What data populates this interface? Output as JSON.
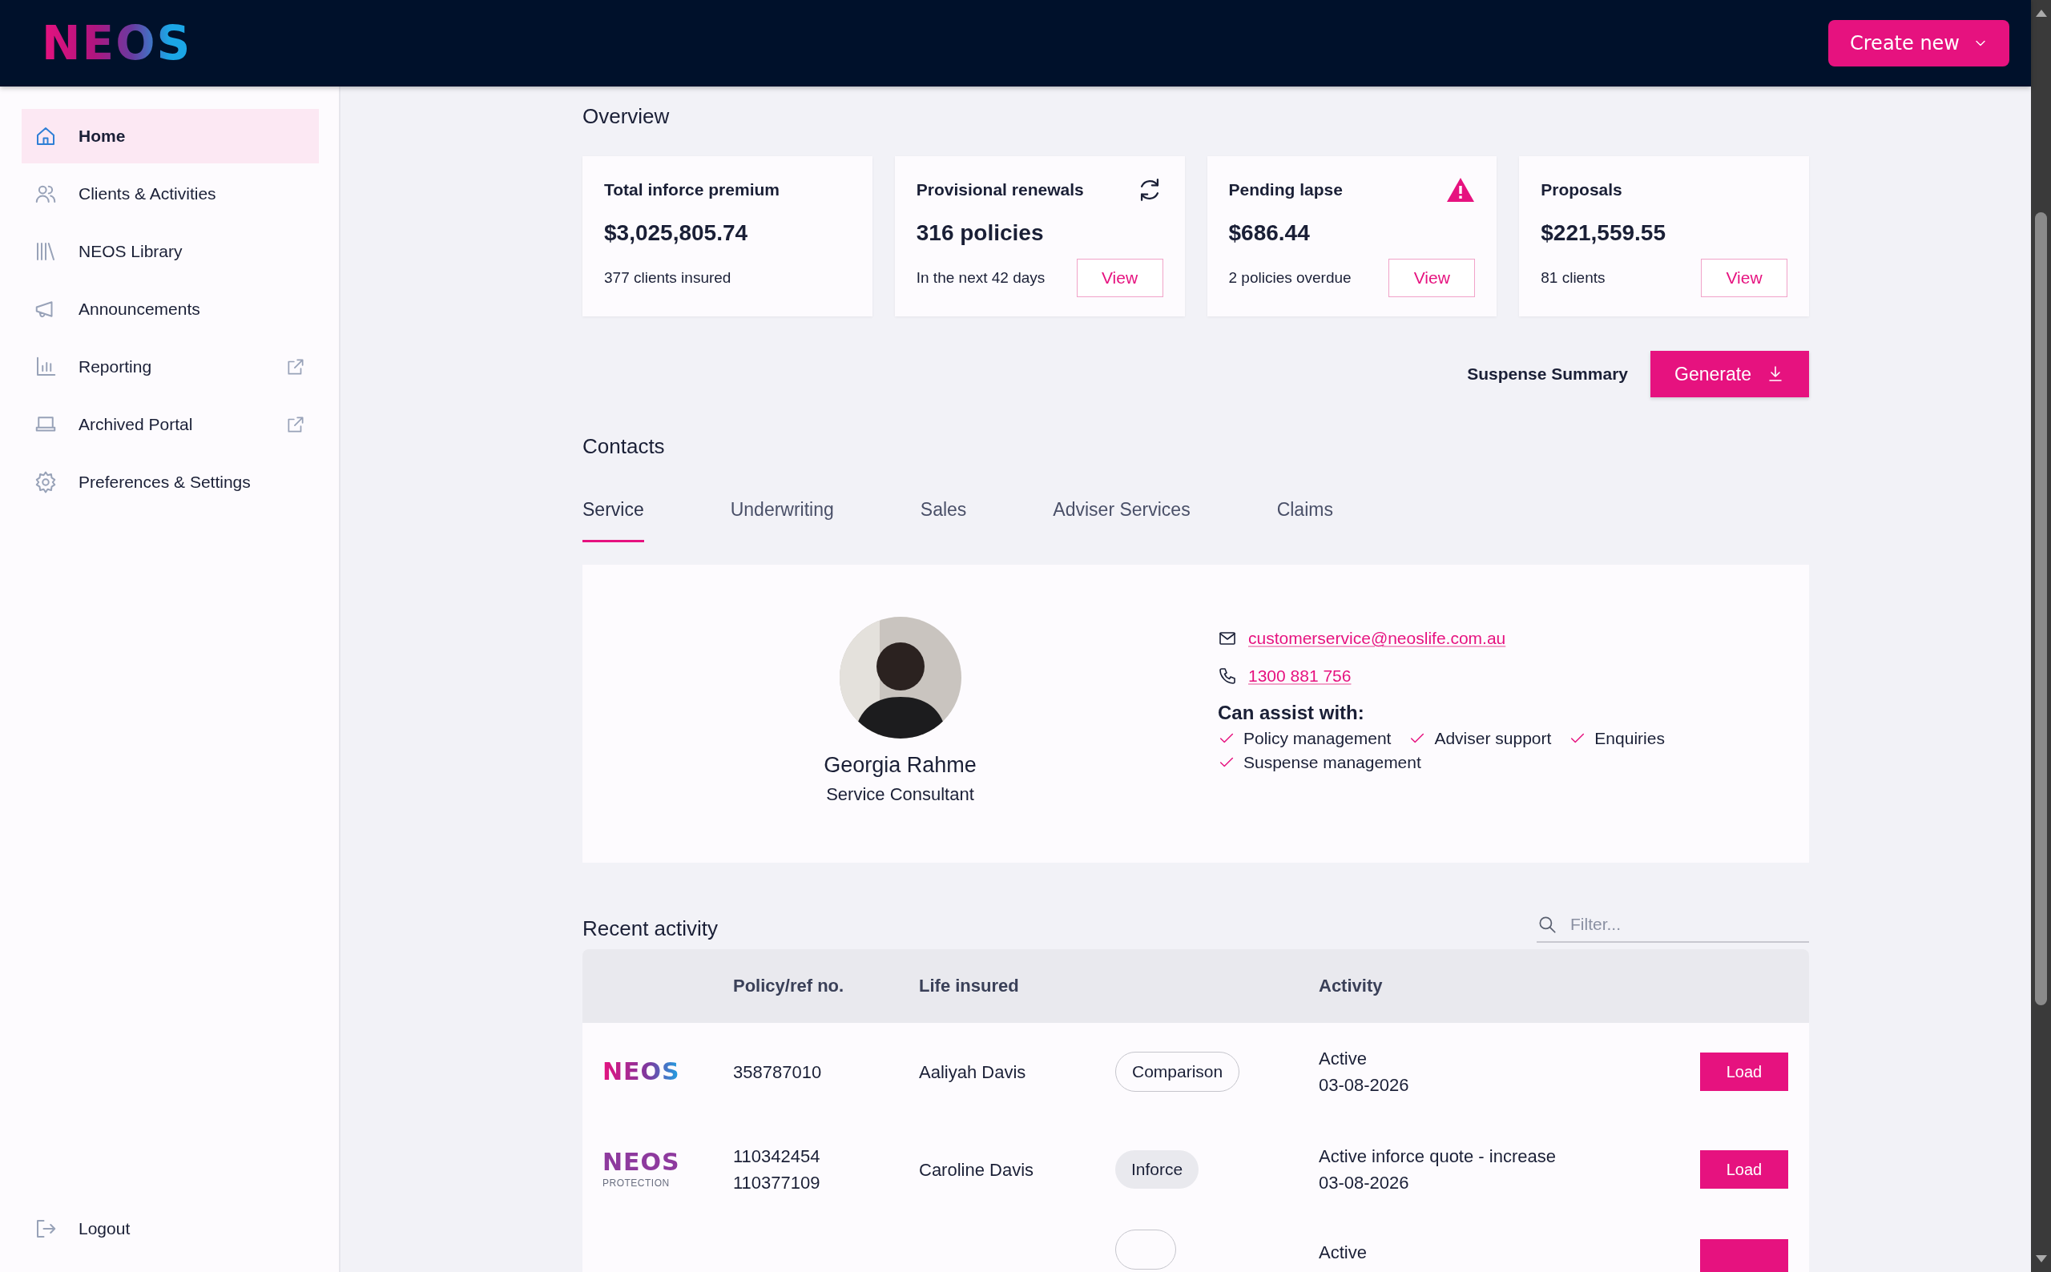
{
  "header": {
    "logo": "NEOS",
    "create_button": "Create new"
  },
  "sidebar": {
    "items": [
      {
        "label": "Home",
        "selected": true,
        "external": false
      },
      {
        "label": "Clients & Activities",
        "selected": false,
        "external": false
      },
      {
        "label": "NEOS Library",
        "selected": false,
        "external": false
      },
      {
        "label": "Announcements",
        "selected": false,
        "external": false
      },
      {
        "label": "Reporting",
        "selected": false,
        "external": true
      },
      {
        "label": "Archived Portal",
        "selected": false,
        "external": true
      },
      {
        "label": "Preferences & Settings",
        "selected": false,
        "external": false
      }
    ],
    "logout": "Logout"
  },
  "overview": {
    "title": "Overview",
    "cards": [
      {
        "kind": "premium",
        "title": "Total inforce premium",
        "value": "$3,025,805.74",
        "note": "377 clients insured"
      },
      {
        "kind": "renewals",
        "title": "Provisional renewals",
        "value": "316 policies",
        "note": "In the next 42 days",
        "action": "View"
      },
      {
        "kind": "lapse",
        "title": "Pending lapse",
        "value": "$686.44",
        "note": "2 policies overdue",
        "action": "View"
      },
      {
        "kind": "proposals",
        "title": "Proposals",
        "value": "$221,559.55",
        "note": "81 clients",
        "action": "View"
      }
    ],
    "suspense": {
      "label": "Suspense Summary",
      "button": "Generate"
    }
  },
  "contacts": {
    "title": "Contacts",
    "tabs": [
      {
        "label": "Service",
        "selected": true
      },
      {
        "label": "Underwriting",
        "selected": false
      },
      {
        "label": "Sales",
        "selected": false
      },
      {
        "label": "Adviser Services",
        "selected": false
      },
      {
        "label": "Claims",
        "selected": false
      }
    ],
    "person": {
      "name": "Georgia Rahme",
      "role": "Service Consultant",
      "email": "customerservice@neoslife.com.au",
      "phone": "1300 881 756",
      "assist_title": "Can assist with:",
      "assist": [
        "Policy management",
        "Adviser support",
        "Enquiries",
        "Suspense management"
      ]
    }
  },
  "activity": {
    "title": "Recent activity",
    "filter_placeholder": "Filter...",
    "columns": {
      "policy": "Policy/ref no.",
      "life": "Life insured",
      "activity": "Activity"
    },
    "rows": [
      {
        "brand": {
          "kind": "neos",
          "name": "NEOS"
        },
        "refs": [
          "358787010"
        ],
        "life": "Aaliyah Davis",
        "tag": {
          "kind": "outline",
          "label": "Comparison"
        },
        "activity": "Active",
        "date": "03-08-2026",
        "button": "Load"
      },
      {
        "brand": {
          "kind": "protection",
          "name": "NEOS",
          "sub": "PROTECTION"
        },
        "refs": [
          "110342454",
          "110377109"
        ],
        "life": "Caroline Davis",
        "tag": {
          "kind": "filled",
          "label": "Inforce"
        },
        "activity": "Active inforce quote - increase",
        "date": "03-08-2026",
        "button": "Load"
      },
      {
        "tag": {
          "kind": "outline"
        },
        "activity": "Active"
      }
    ]
  }
}
